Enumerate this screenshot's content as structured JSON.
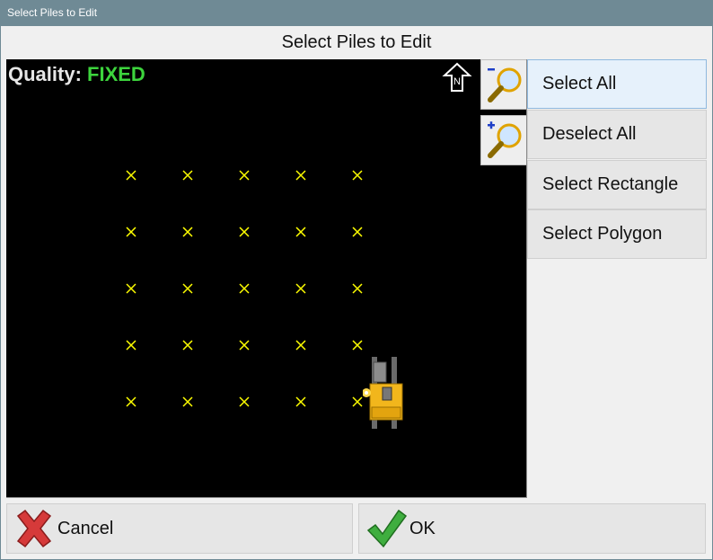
{
  "window": {
    "title": "Select Piles to Edit"
  },
  "dialog": {
    "heading": "Select Piles to Edit"
  },
  "map": {
    "quality_label": "Quality:",
    "quality_value": "FIXED",
    "quality_color": "#3dd43d",
    "background": "#000000",
    "pile_color": "#ffff00",
    "north_label": "N",
    "pile_rows": 5,
    "pile_cols": 5
  },
  "sidebar": {
    "select_all": "Select All",
    "deselect_all": "Deselect All",
    "select_rectangle": "Select Rectangle",
    "select_polygon": "Select Polygon"
  },
  "footer": {
    "cancel": "Cancel",
    "ok": "OK"
  }
}
